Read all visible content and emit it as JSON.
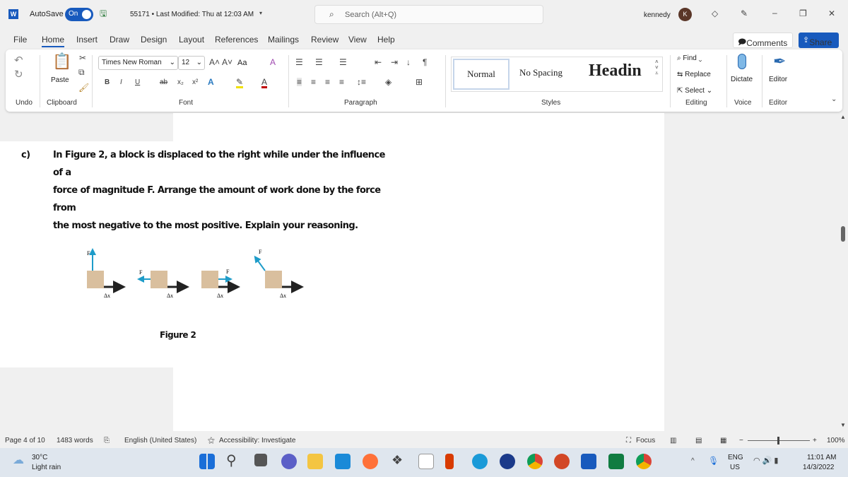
{
  "titlebar": {
    "autosave_label": "AutoSave",
    "autosave_state": "On",
    "doc_title": "55171 • Last Modified: Thu at 12:03 AM",
    "search_placeholder": "Search (Alt+Q)",
    "user_name": "kennedy",
    "avatar_initial": "K"
  },
  "menu": {
    "tabs": [
      "File",
      "Home",
      "Insert",
      "Draw",
      "Design",
      "Layout",
      "References",
      "Mailings",
      "Review",
      "View",
      "Help"
    ],
    "active": "Home",
    "comments": "Comments",
    "share": "Share"
  },
  "ribbon": {
    "font_name": "Times New Roman",
    "font_size": "12",
    "paste": "Paste",
    "case": "Aa",
    "styles": [
      "Normal",
      "No Spacing",
      "Headin"
    ],
    "find": "Find",
    "replace": "Replace",
    "select": "Select",
    "dictate": "Dictate",
    "editor": "Editor",
    "groups": {
      "undo": "Undo",
      "clipboard": "Clipboard",
      "font": "Font",
      "paragraph": "Paragraph",
      "styles": "Styles",
      "editing": "Editing",
      "voice": "Voice",
      "editor": "Editor"
    }
  },
  "document": {
    "item_label": "c)",
    "question_lines": [
      "In Figure 2, a block is displaced to the right while under the influence of a",
      "force of magnitude F. Arrange the amount of work done by the force from",
      "the most negative to the most positive. Explain your reasoning."
    ],
    "force_label": "F",
    "displacement_label": "Δx",
    "figure_caption": "Figure 2"
  },
  "status": {
    "page": "Page 4 of 10",
    "words": "1483 words",
    "language": "English (United States)",
    "accessibility": "Accessibility: Investigate",
    "focus": "Focus",
    "zoom": "100%",
    "zoom_level": 100
  },
  "taskbar": {
    "temp": "30°C",
    "weather": "Light rain",
    "lang1": "ENG",
    "lang2": "US",
    "time": "11:01 AM",
    "date": "14/3/2022"
  },
  "colors": {
    "word_blue": "#185abd",
    "force_arrow": "#1e9cc9",
    "block": "#d9bf9e"
  }
}
